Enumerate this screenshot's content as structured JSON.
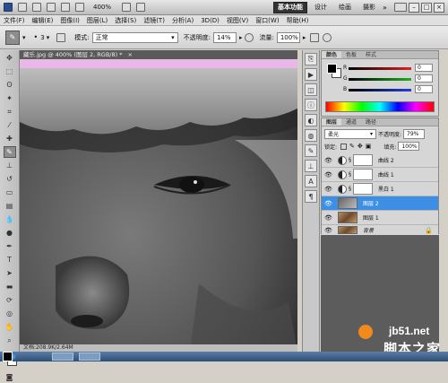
{
  "appbar": {
    "zoom": "400%",
    "workspaces": [
      "基本功能",
      "设计",
      "绘画",
      "摄影"
    ],
    "active_workspace": "基本功能",
    "expand": "»"
  },
  "menu": [
    "文件(F)",
    "编辑(E)",
    "图像(I)",
    "图层(L)",
    "选择(S)",
    "滤镜(T)",
    "分析(A)",
    "3D(D)",
    "视图(V)",
    "窗口(W)",
    "帮助(H)"
  ],
  "options": {
    "brush_size": "3",
    "mode_label": "模式:",
    "mode_value": "正常",
    "opacity_label": "不透明度:",
    "opacity_value": "14%",
    "flow_label": "流量:",
    "flow_value": "100%"
  },
  "document": {
    "tab_title": "藏乐.jpg @ 400% (图层 2, RGB/8) *",
    "status": "文档:208.9K/2.64M"
  },
  "color_panel": {
    "tabs": [
      "颜色",
      "色板",
      "样式"
    ],
    "r_label": "R",
    "g_label": "G",
    "b_label": "B",
    "r_value": "0",
    "g_value": "0",
    "b_value": "0"
  },
  "layers_panel": {
    "tabs": [
      "图层",
      "通道",
      "路径"
    ],
    "blend_mode": "柔光",
    "opacity_label": "不透明度:",
    "opacity_value": "79%",
    "lock_label": "锁定:",
    "fill_label": "填充:",
    "fill_value": "100%",
    "layers": [
      {
        "name": "曲线 2",
        "type": "adjustment"
      },
      {
        "name": "曲线 1",
        "type": "adjustment"
      },
      {
        "name": "黑白 1",
        "type": "adjustment"
      },
      {
        "name": "图层 2",
        "type": "image-gray",
        "selected": true
      },
      {
        "name": "图层 1",
        "type": "image"
      },
      {
        "name": "背景",
        "type": "image",
        "locked": true
      }
    ]
  },
  "watermark": {
    "site": "jb51.net",
    "brand": "脚本之家"
  },
  "colors": {
    "selected_layer": "#3d8fe6",
    "doc_strip": "#e8b8e8",
    "red_slider": "#e02020",
    "green_slider": "#20b020",
    "blue_slider": "#2040e0"
  }
}
